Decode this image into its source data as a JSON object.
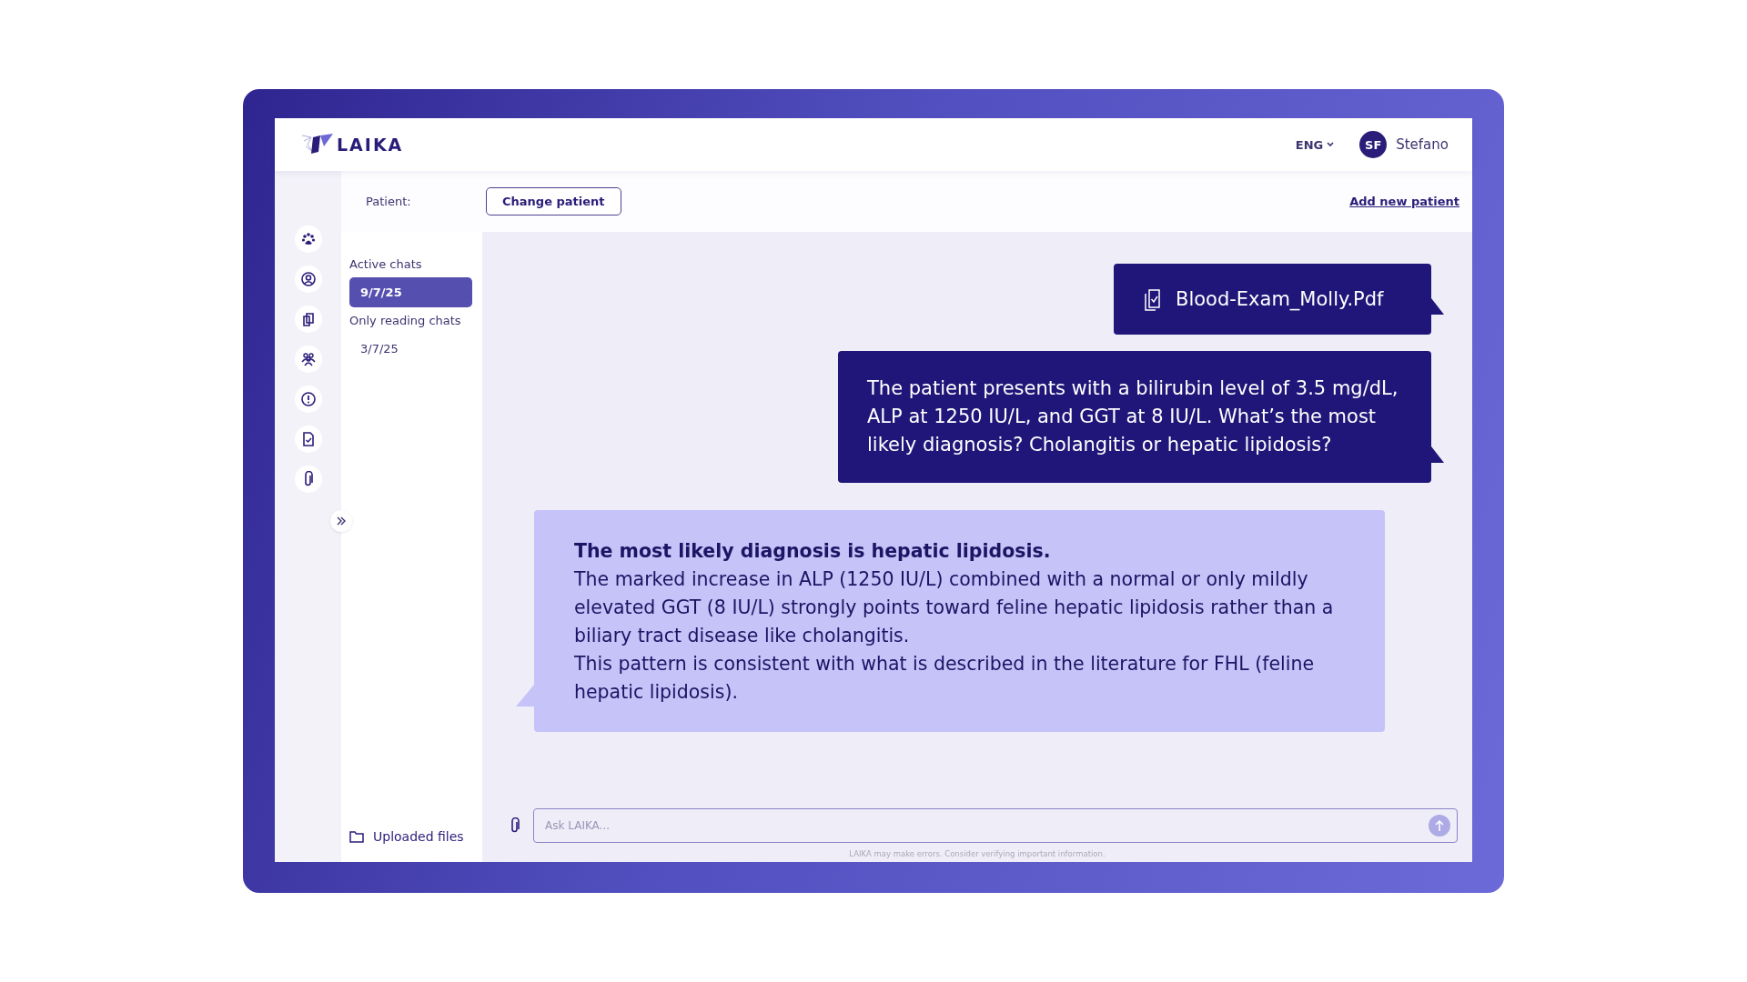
{
  "header": {
    "logo": "LAIKA",
    "language": "ENG",
    "user": {
      "initials": "SF",
      "name": "Stefano"
    }
  },
  "patient_bar": {
    "label": "Patient:",
    "change_button": "Change patient",
    "add_link": "Add new patient"
  },
  "chat_sections": [
    {
      "title": "Active chats",
      "items": [
        {
          "label": "9/7/25",
          "selected": true
        }
      ]
    },
    {
      "title": "Only reading chats",
      "items": [
        {
          "label": "3/7/25",
          "selected": false
        }
      ]
    }
  ],
  "uploaded_files": "Uploaded files",
  "messages": [
    {
      "kind": "file",
      "text": "Blood-Exam_Molly.Pdf"
    },
    {
      "kind": "question",
      "text": "The patient presents with a bilirubin level of 3.5 mg/dL, ALP at 1250 IU/L, and GGT at 8 IU/L. What’s the most likely diagnosis? Cholangitis or hepatic lipidosis?"
    },
    {
      "kind": "answer",
      "paragraphs": [
        {
          "kind": "heading",
          "text": "The most likely diagnosis is hepatic lipidosis."
        },
        {
          "kind": "body",
          "text": "The marked increase in ALP (1250 IU/L) combined with a normal or only mildly elevated GGT (8 IU/L) strongly points toward feline hepatic lipidosis rather than a biliary tract disease like cholangitis."
        },
        {
          "kind": "body",
          "text": "This pattern is consistent with what is described in the literature for FHL (feline hepatic lipidosis)."
        }
      ]
    }
  ],
  "composer": {
    "placeholder": "Ask LAIKA...",
    "disclaimer": "LAIKA may make errors. Consider verifying important information."
  }
}
